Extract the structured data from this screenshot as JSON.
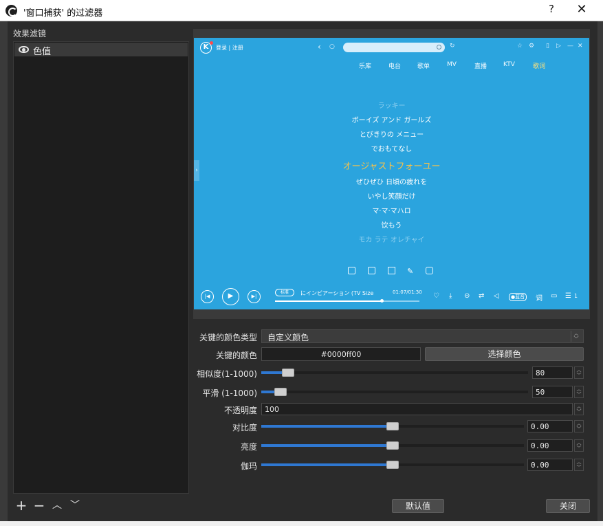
{
  "window": {
    "title": "'窗口捕获' 的过滤器",
    "help_label": "?",
    "close_label": "✕"
  },
  "filters": {
    "section_label": "效果滤镜",
    "items": [
      {
        "label": "色值",
        "visible": true
      }
    ],
    "tools": {
      "add": "+",
      "remove": "−",
      "up": "︿",
      "down": "﹀"
    }
  },
  "preview": {
    "logo": "K",
    "login": "登录 | 注册",
    "tabs": [
      "乐库",
      "电台",
      "歌单",
      "MV",
      "直播",
      "KTV",
      "歌词"
    ],
    "lyrics": [
      {
        "text": "ラッキー",
        "state": "faded"
      },
      {
        "text": "ボーイズ アンド ガールズ",
        "state": "normal"
      },
      {
        "text": "とびきりの メニュー",
        "state": "normal"
      },
      {
        "text": "でおもてなし",
        "state": "normal"
      },
      {
        "text": "オージャストフォーユー",
        "state": "current"
      },
      {
        "text": "ぜひぜひ 日頃の疲れを",
        "state": "normal"
      },
      {
        "text": "いやし笑顔だけ",
        "state": "normal"
      },
      {
        "text": "マ·マ·マハロ",
        "state": "normal"
      },
      {
        "text": "饮もう",
        "state": "normal"
      },
      {
        "text": "モカ ラテ オレチャイ",
        "state": "faded"
      }
    ],
    "player": {
      "chip": "标准",
      "song": "にインピアーション (TV Size",
      "time": "01:07/01:30",
      "progress": 0.74,
      "quality": "●蓝音",
      "lyric_btn": "词",
      "queue_count": "1"
    }
  },
  "properties": {
    "key_color_type_label": "关键的颜色类型",
    "key_color_type_value": "自定义颜色",
    "key_color_label": "关键的颜色",
    "key_color_value": "#0000ff00",
    "pick_color_button": "选择颜色",
    "similarity_label": "相似度(1-1000)",
    "similarity_value": "80",
    "similarity_fraction": 0.08,
    "smoothness_label": "平滑 (1-1000)",
    "smoothness_value": "50",
    "smoothness_fraction": 0.05,
    "opacity_label": "不透明度",
    "opacity_value": "100",
    "contrast_label": "对比度",
    "contrast_value": "0.00",
    "contrast_fraction": 0.5,
    "brightness_label": "亮度",
    "brightness_value": "0.00",
    "brightness_fraction": 0.5,
    "gamma_label": "伽玛",
    "gamma_value": "0.00",
    "gamma_fraction": 0.5
  },
  "footer": {
    "defaults_button": "默认值",
    "close_button": "关闭"
  },
  "colors": {
    "accent": "#2f78d2",
    "preview_bg": "#2ba4de",
    "current_lyric": "#f6c24a"
  }
}
